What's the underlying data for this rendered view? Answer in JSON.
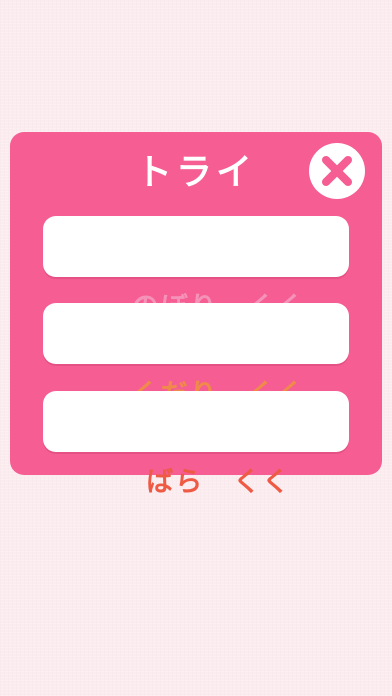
{
  "dialog": {
    "title": "トライ",
    "accent_color": "#f55d93",
    "close_icon": "close-icon",
    "buttons": [
      {
        "label": "のぼり　くく",
        "color": "#f592b8"
      },
      {
        "label": "くだり　くく",
        "color": "#f08a4b"
      },
      {
        "label": "ばら　くく",
        "color": "#ef5a45"
      }
    ]
  }
}
